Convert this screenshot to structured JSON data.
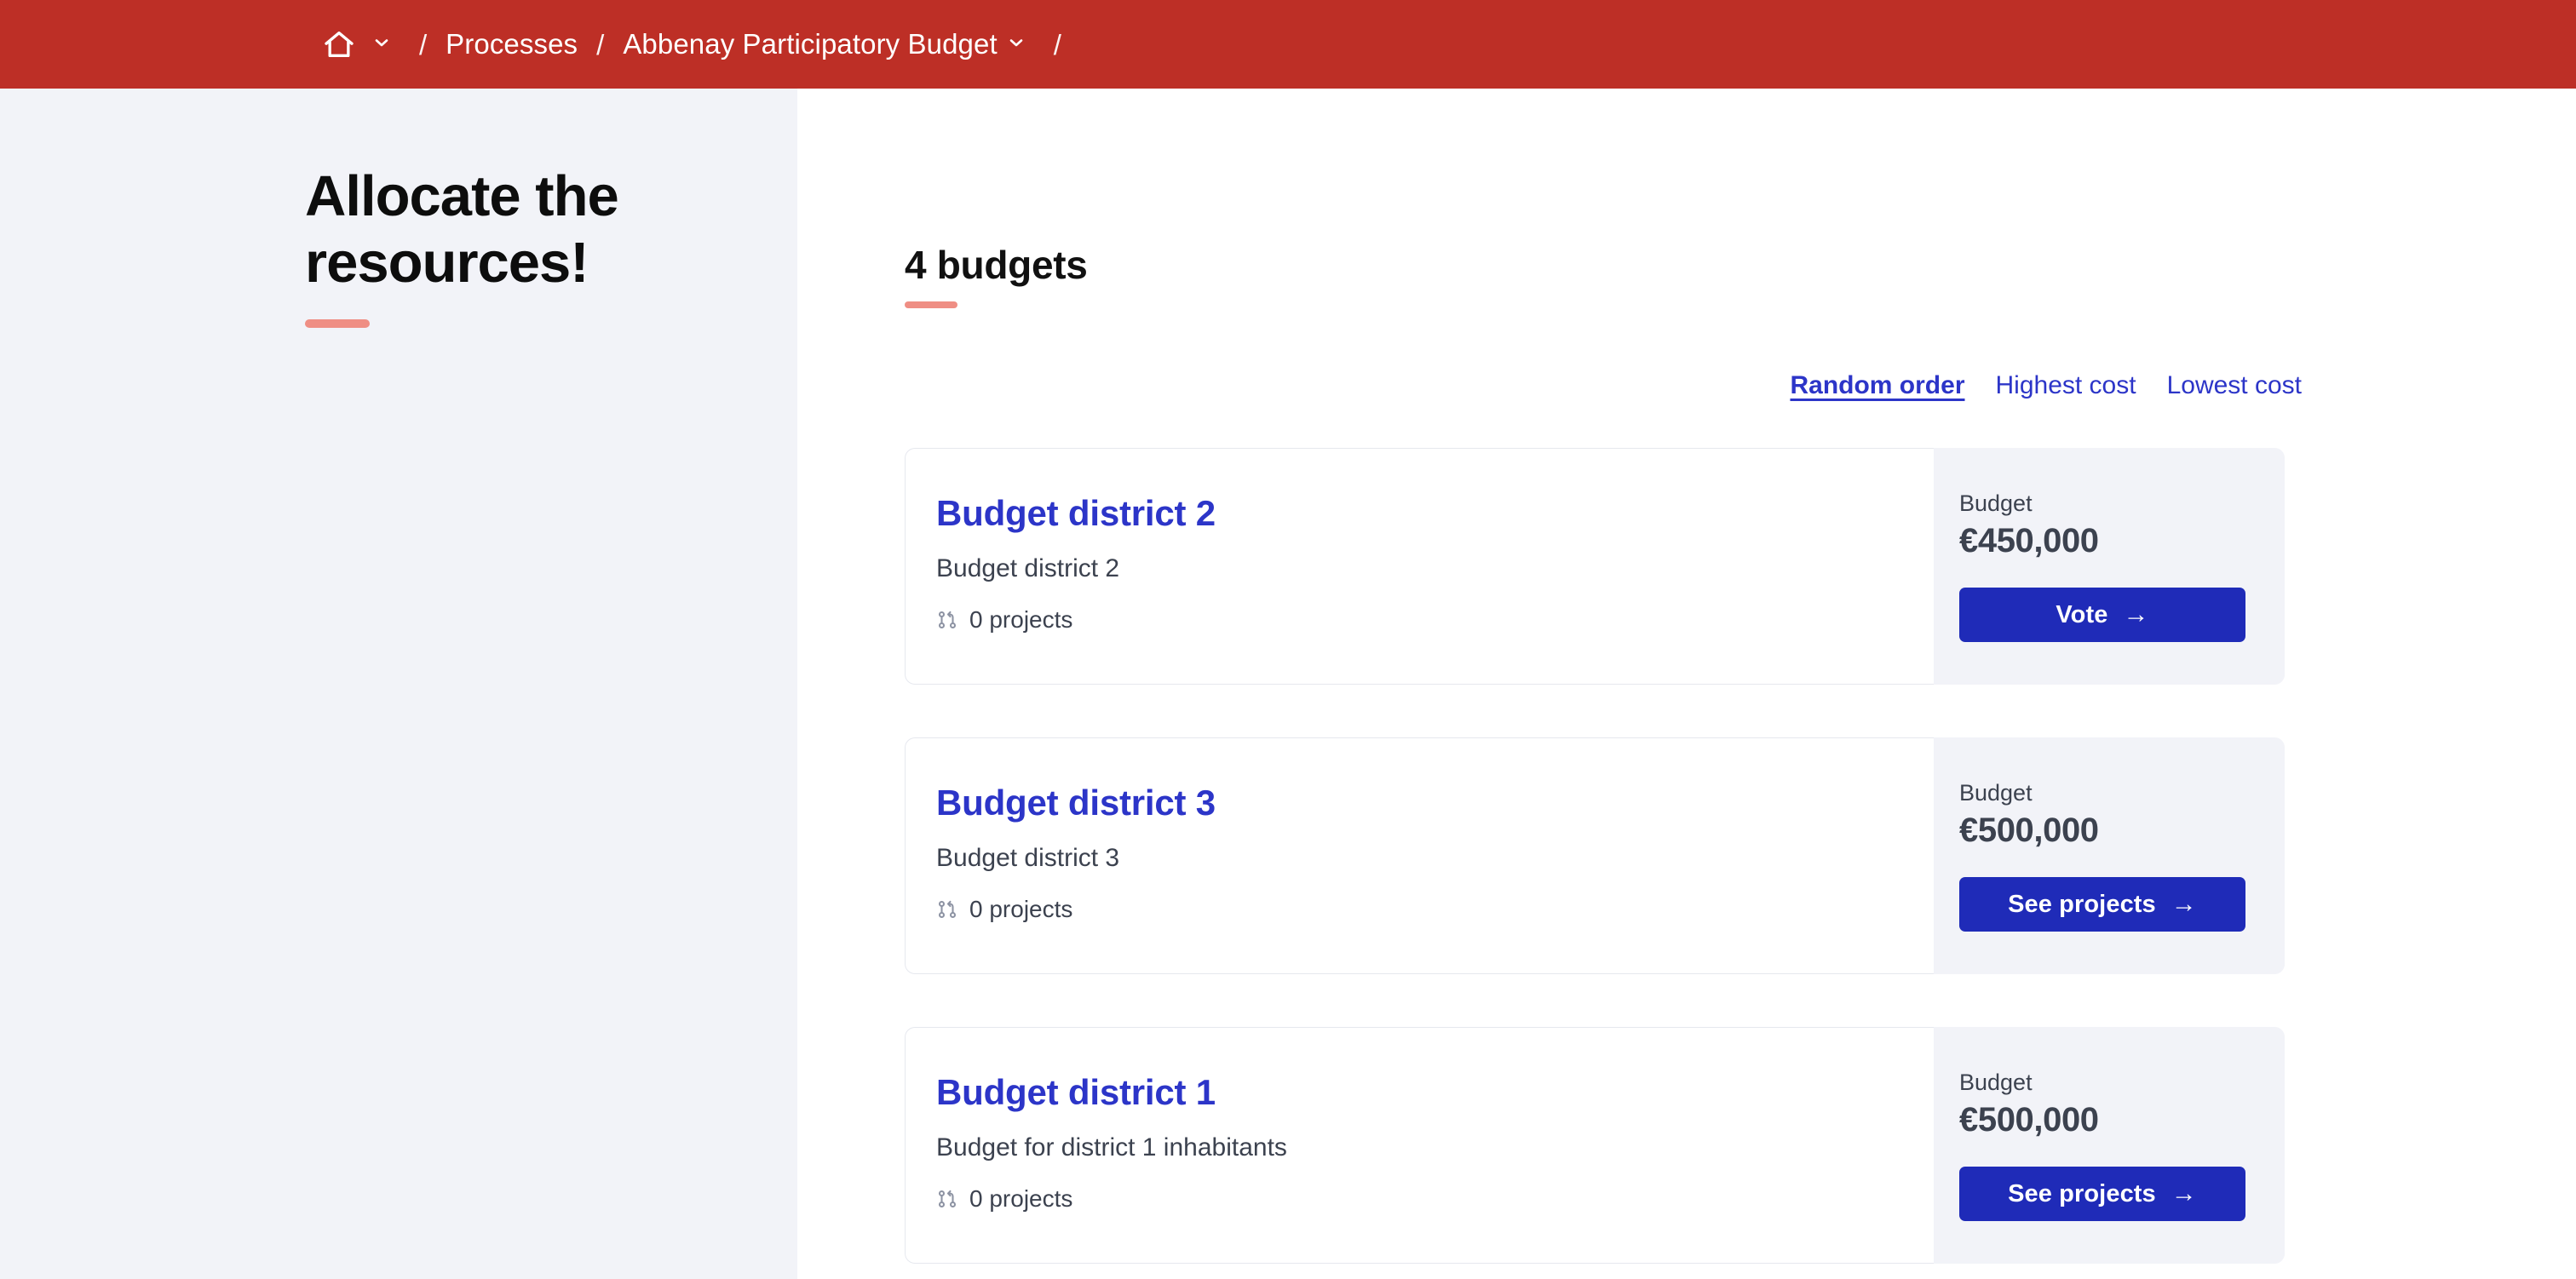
{
  "topbar": {
    "background": "#bd2f26",
    "home_icon": "home-icon",
    "home_caret_icon": "chevron-down-icon",
    "separator": "/",
    "crumbs": [
      {
        "label": "Processes"
      },
      {
        "label": "Abbenay Participatory Budget"
      }
    ],
    "process_caret_icon": "chevron-down-icon"
  },
  "sidebar": {
    "title": "Allocate the resources!",
    "accent_color": "#ef8e84",
    "background": "#f2f3f8"
  },
  "main": {
    "heading": "4 budgets",
    "heading_accent_color": "#ef8e84",
    "order": {
      "links": [
        {
          "label": "Random order",
          "active": true
        },
        {
          "label": "Highest cost",
          "active": false
        },
        {
          "label": "Lowest cost",
          "active": false
        }
      ],
      "link_color": "#2c35c8"
    },
    "budget_label": "Budget",
    "projects_icon": "git-branch-icon",
    "button_arrow": "→",
    "button_color": "#1f2bb8",
    "cards": [
      {
        "title": "Budget district 2",
        "description": "Budget district 2",
        "projects": "0 projects",
        "budget_label": "Budget",
        "amount": "€450,000",
        "action_label": "Vote"
      },
      {
        "title": "Budget district 3",
        "description": "Budget district 3",
        "projects": "0 projects",
        "budget_label": "Budget",
        "amount": "€500,000",
        "action_label": "See projects"
      },
      {
        "title": "Budget district 1",
        "description": "Budget for district 1 inhabitants",
        "projects": "0 projects",
        "budget_label": "Budget",
        "amount": "€500,000",
        "action_label": "See projects"
      }
    ]
  }
}
